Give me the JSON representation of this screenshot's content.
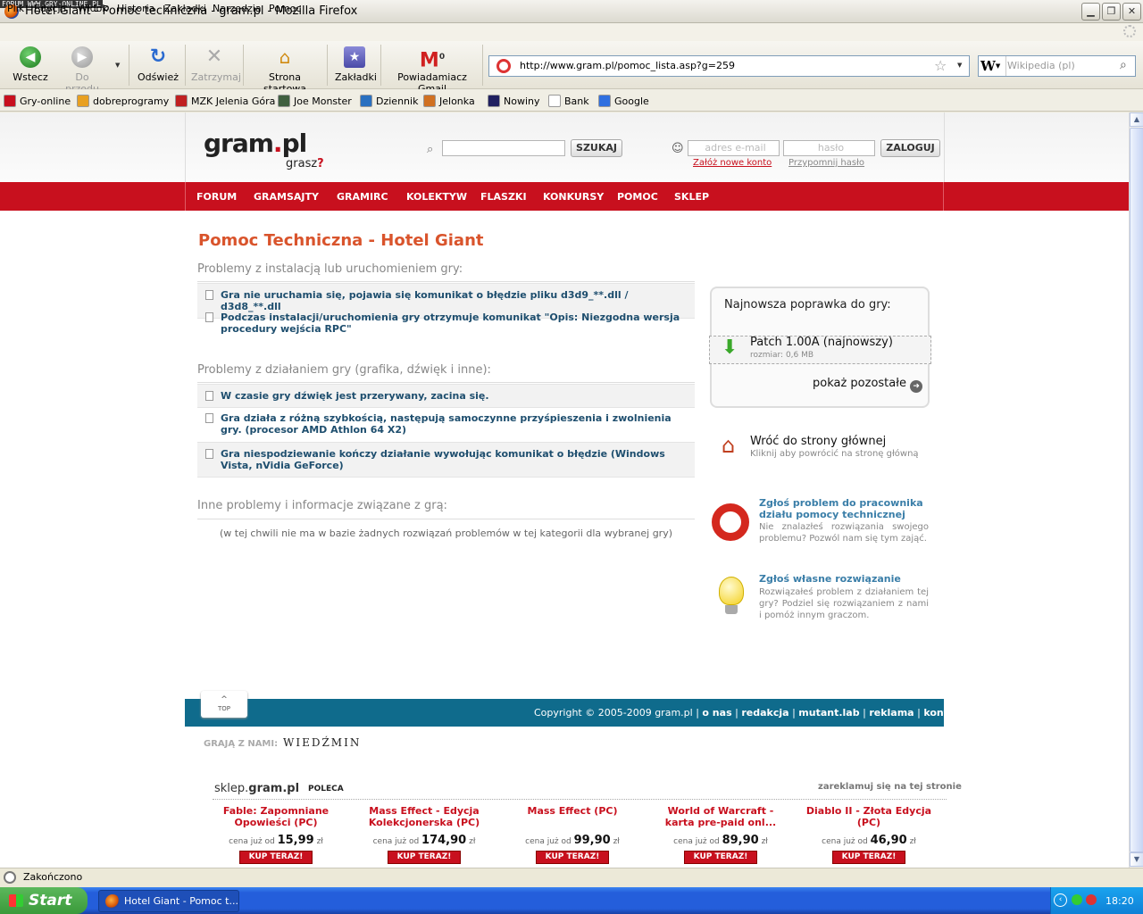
{
  "window": {
    "title": "Hotel Giant - Pomoc techniczna - gram.pl - Mozilla Firefox",
    "watermark": "FORUM WWW.GRY-ONLINE.PL"
  },
  "menu": [
    "Plik",
    "Edycja",
    "Widok",
    "Historia",
    "Zakładki",
    "Narzędzia",
    "Pomoc"
  ],
  "toolbar": {
    "back": "Wstecz",
    "forward": "Do przodu",
    "reload": "Odśwież",
    "stop": "Zatrzymaj",
    "home": "Strona startowa",
    "bookmarks": "Zakładki",
    "gmail": "Powiadamiacz Gmail",
    "gmail_count": "0"
  },
  "address": {
    "url": "http://www.gram.pl/pomoc_lista.asp?g=259"
  },
  "search": {
    "placeholder": "Wikipedia (pl)",
    "engine_letter": "W"
  },
  "bookmarks": [
    {
      "label": "Gry-online",
      "color": "#c8101e"
    },
    {
      "label": "dobreprogramy",
      "color": "#e8a020"
    },
    {
      "label": "MZK Jelenia Góra",
      "color": "#c02020"
    },
    {
      "label": "Joe Monster",
      "color": "#406040"
    },
    {
      "label": "Dziennik",
      "color": "#2a70c0"
    },
    {
      "label": "Jelonka",
      "color": "#d07020"
    },
    {
      "label": "Nowiny",
      "color": "#202060"
    },
    {
      "label": "Bank",
      "color": "#ffffff"
    },
    {
      "label": "Google",
      "color": "#3070e0"
    }
  ],
  "site": {
    "logo": "gram",
    "logo_dot": ".",
    "logo_tld": "pl",
    "slogan": "grasz",
    "slogan_q": "?",
    "search_button": "SZUKAJ",
    "email_placeholder": "adres e-mail",
    "password_placeholder": "hasło",
    "login_button": "ZALOGUJ",
    "register_link": "Załóż nowe konto",
    "remind_link": "Przypomnij hasło",
    "nav": [
      "FORUM",
      "GRAMSAJTY",
      "GRAMIRC",
      "KOLEKTYW",
      "FLASZKI",
      "KONKURSY",
      "POMOC",
      "SKLEP"
    ]
  },
  "content": {
    "title": "Pomoc Techniczna - Hotel Giant",
    "sections": [
      {
        "heading": "Problemy z instalacją lub uruchomieniem gry:",
        "items": [
          "Gra nie uruchamia się, pojawia się komunikat o błędzie pliku d3d9_**.dll / d3d8_**.dll",
          "Podczas instalacji/uruchomienia gry otrzymuje komunikat \"Opis: Niezgodna wersja procedury wejścia RPC\""
        ]
      },
      {
        "heading": "Problemy z działaniem gry (grafika, dźwięk i inne):",
        "items": [
          "W czasie gry dźwięk jest przerywany, zacina się.",
          "Gra działa z różną szybkością, następują samoczynne przyśpieszenia i zwolnienia gry. (procesor AMD Athlon 64 X2)",
          "Gra niespodziewanie kończy działanie wywołując komunikat o błędzie (Windows Vista, nVidia GeForce)"
        ]
      },
      {
        "heading": "Inne problemy i informacje związane z grą:",
        "items": []
      }
    ],
    "no_solutions": "(w tej chwili nie ma w bazie żadnych rozwiązań problemów w tej kategorii dla wybranej gry)"
  },
  "sidebar": {
    "patch_title": "Najnowsza poprawka do gry:",
    "patch_name": "Patch 1.00A (najnowszy)",
    "patch_size": "rozmiar: 0,6 MB",
    "show_more": "pokaż pozostałe",
    "home_title": "Wróć do strony głównej",
    "home_text": "Kliknij aby powrócić na stronę główną",
    "report_title": "Zgłoś problem do pracownika działu pomocy technicznej",
    "report_text": "Nie znalazłeś rozwiązania swojego problemu? Pozwól nam się tym zająć.",
    "solution_title": "Zgłoś własne rozwiązanie",
    "solution_text": "Rozwiązałeś problem z działaniem tej gry? Podziel się rozwiązaniem z nami i pomóż innym graczom."
  },
  "footer": {
    "top_label": "TOP",
    "copyright": "Copyright © 2005-2009 gram.pl",
    "links": [
      "o nas",
      "redakcja",
      "mutant.lab",
      "reklama",
      "kontakt"
    ],
    "separator": "|",
    "play_with": "GRAJĄ Z NAMI:",
    "witcher": "WIEDŹMIN"
  },
  "shop": {
    "brand_prefix": "sklep.",
    "brand": "gram.pl",
    "recommends": "POLECA",
    "advertise": "zareklamuj się na tej stronie",
    "price_prefix": "cena już od",
    "currency": "zł",
    "buy": "KUP TERAZ!",
    "products": [
      {
        "name": "Fable: Zapomniane Opowieści (PC)",
        "price": "15,99"
      },
      {
        "name": "Mass Effect - Edycja Kolekcjonerska (PC)",
        "price": "174,90"
      },
      {
        "name": "Mass Effect (PC)",
        "price": "99,90"
      },
      {
        "name": "World of Warcraft - karta pre-paid onl...",
        "price": "89,90"
      },
      {
        "name": "Diablo II - Złota Edycja (PC)",
        "price": "46,90"
      }
    ]
  },
  "status": {
    "text": "Zakończono"
  },
  "taskbar": {
    "start": "Start",
    "task": "Hotel Giant - Pomoc t...",
    "clock": "18:20"
  }
}
